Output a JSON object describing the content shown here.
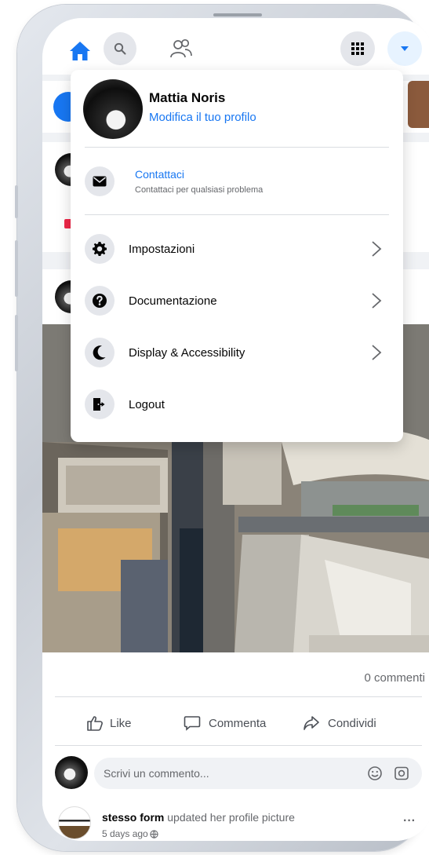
{
  "profile": {
    "name": "Mattia Noris",
    "edit_link": "Modifica il tuo profilo"
  },
  "menu": {
    "contact": {
      "title": "Contattaci",
      "subtitle": "Contattaci per qualsiasi problema"
    },
    "items": [
      {
        "icon": "gear-icon",
        "label": "Impostazioni"
      },
      {
        "icon": "question-icon",
        "label": "Documentazione"
      },
      {
        "icon": "moon-icon",
        "label": "Display & Accessibility"
      },
      {
        "icon": "logout-icon",
        "label": "Logout"
      }
    ]
  },
  "post": {
    "comments_count": "0 commenti",
    "actions": {
      "like": "Like",
      "comment": "Commenta",
      "share": "Condividi"
    },
    "comment_placeholder": "Scrivi un commento..."
  },
  "next_post": {
    "author": "stesso form",
    "action": "updated her profile picture",
    "time": "5 days ago",
    "more": "···"
  },
  "colors": {
    "accent": "#1877f2",
    "bg": "#f0f2f5",
    "text": "#050505",
    "muted": "#65676b"
  }
}
